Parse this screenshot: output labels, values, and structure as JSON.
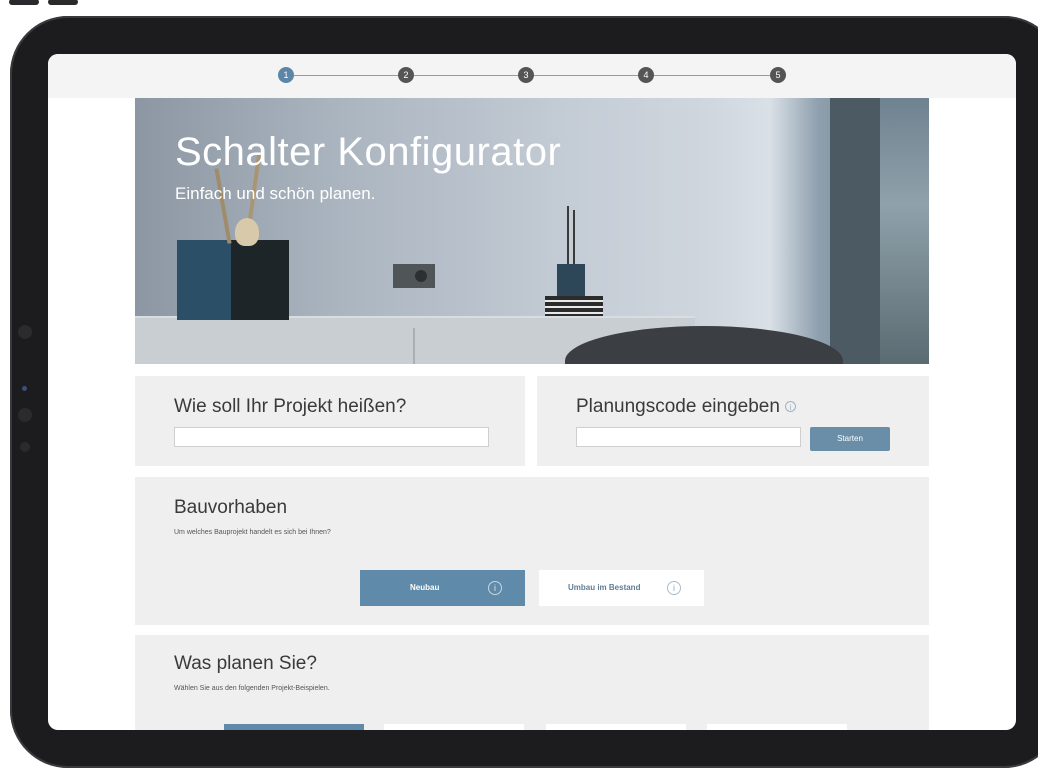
{
  "steps": [
    "1",
    "2",
    "3",
    "4",
    "5"
  ],
  "active_step": 1,
  "hero": {
    "title": "Schalter Konfigurator",
    "subtitle": "Einfach und schön planen."
  },
  "project": {
    "title": "Wie soll Ihr Projekt heißen?",
    "value": ""
  },
  "code": {
    "title": "Planungscode eingeben",
    "info_icon": "i",
    "value": "",
    "button": "Starten"
  },
  "bauvorhaben": {
    "title": "Bauvorhaben",
    "description": "Um welches Bauprojekt handelt es sich bei Ihnen?",
    "options": [
      {
        "label": "Neubau",
        "icon": "i",
        "selected": true
      },
      {
        "label": "Umbau im Bestand",
        "icon": "i",
        "selected": false
      }
    ]
  },
  "planen": {
    "title": "Was planen Sie?",
    "description": "Wählen Sie aus den folgenden Projekt-Beispielen."
  },
  "colors": {
    "accent": "#5d86a6",
    "panel": "#efefef",
    "button": "#6a8ea8"
  }
}
